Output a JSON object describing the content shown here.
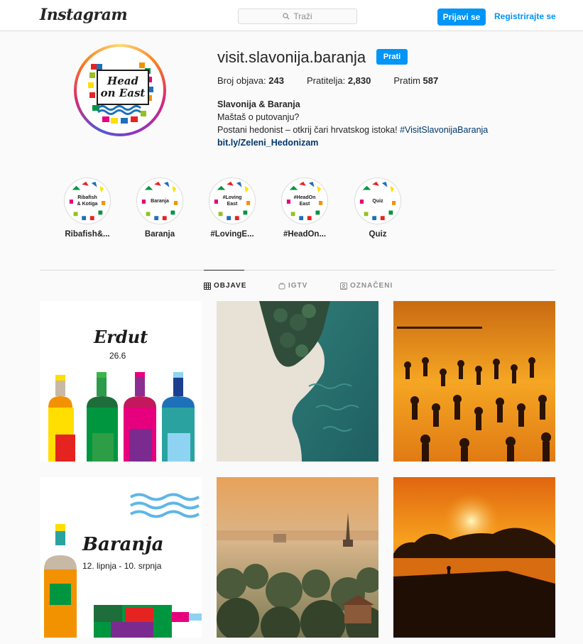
{
  "header": {
    "logo": "Instagram",
    "search_placeholder": "Traži",
    "login_label": "Prijavi se",
    "register_label": "Registrirajte se"
  },
  "profile": {
    "username": "visit.slavonija.baranja",
    "follow_label": "Prati",
    "avatar_text_line1": "Head",
    "avatar_text_line2": "on East",
    "stats": {
      "posts_label": "Broj objava:",
      "posts_value": "243",
      "followers_label": "Pratitelja:",
      "followers_value": "2,830",
      "following_label": "Pratim",
      "following_value": "587"
    },
    "bio": {
      "name": "Slavonija & Baranja",
      "line1": "Maštaš o putovanju?",
      "line2": "Postani hedonist – otkrij čari hrvatskog istoka!",
      "hashtag": "#VisitSlavonijaBaranja",
      "link": "bit.ly/Zeleni_Hedonizam"
    }
  },
  "highlights": [
    {
      "cover_text": "Ribafish & Kotiga",
      "label": "Ribafish&..."
    },
    {
      "cover_text": "Baranja",
      "label": "Baranja"
    },
    {
      "cover_text": "#Loving East",
      "label": "#LovingE..."
    },
    {
      "cover_text": "#HeadOn East",
      "label": "#HeadOn..."
    },
    {
      "cover_text": "Quiz",
      "label": "Quiz"
    }
  ],
  "tabs": [
    {
      "label": "OBJAVE",
      "icon": "grid-icon",
      "active": true
    },
    {
      "label": "IGTV",
      "icon": "igtv-icon",
      "active": false
    },
    {
      "label": "OZNAČENI",
      "icon": "tagged-icon",
      "active": false
    }
  ],
  "posts": [
    {
      "title": "Erdut",
      "subtitle": "26.6"
    },
    {
      "title": "",
      "subtitle": ""
    },
    {
      "title": "",
      "subtitle": ""
    },
    {
      "title": "Baranja",
      "subtitle": "12. lipnja - 10. srpnja"
    },
    {
      "title": "",
      "subtitle": ""
    },
    {
      "title": "",
      "subtitle": ""
    }
  ],
  "colors": {
    "accent": "#0095f6",
    "link": "#00376b",
    "border": "#dbdbdb"
  }
}
